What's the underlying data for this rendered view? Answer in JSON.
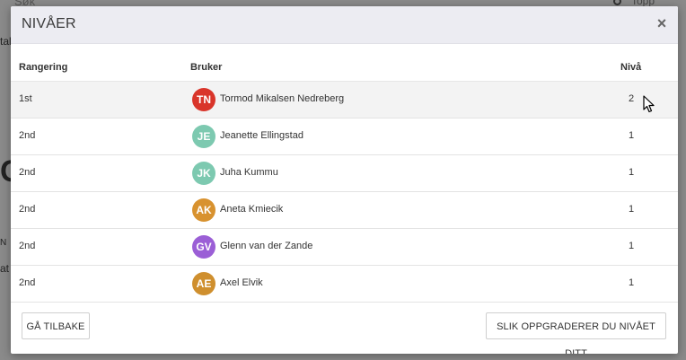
{
  "background": {
    "search_text": "Søk",
    "radio_label": "Topp",
    "fragment_1": "tal",
    "fragment_2": "C",
    "fragment_3": "N",
    "fragment_4": "at"
  },
  "modal": {
    "title": "NIVÅER",
    "close_label": "×",
    "columns": {
      "rank": "Rangering",
      "user": "Bruker",
      "level": "Nivå"
    },
    "rows": [
      {
        "rank": "1st",
        "initials": "TN",
        "name": "Tormod Mikalsen Nedreberg",
        "level": "2",
        "avatar_color": "#d9352a"
      },
      {
        "rank": "2nd",
        "initials": "JE",
        "name": "Jeanette Ellingstad",
        "level": "1",
        "avatar_color": "#7dc9b0"
      },
      {
        "rank": "2nd",
        "initials": "JK",
        "name": "Juha Kummu",
        "level": "1",
        "avatar_color": "#7dc9b0"
      },
      {
        "rank": "2nd",
        "initials": "AK",
        "name": "Aneta Kmiecik",
        "level": "1",
        "avatar_color": "#d8922f"
      },
      {
        "rank": "2nd",
        "initials": "GV",
        "name": "Glenn van der Zande",
        "level": "1",
        "avatar_color": "#9b5fd6"
      },
      {
        "rank": "2nd",
        "initials": "AE",
        "name": "Axel Elvik",
        "level": "1",
        "avatar_color": "#cf8f2e"
      }
    ],
    "back_button": "GÅ TILBAKE",
    "upgrade_button": "SLIK OPPGRADERER DU NIVÅET DITT"
  }
}
